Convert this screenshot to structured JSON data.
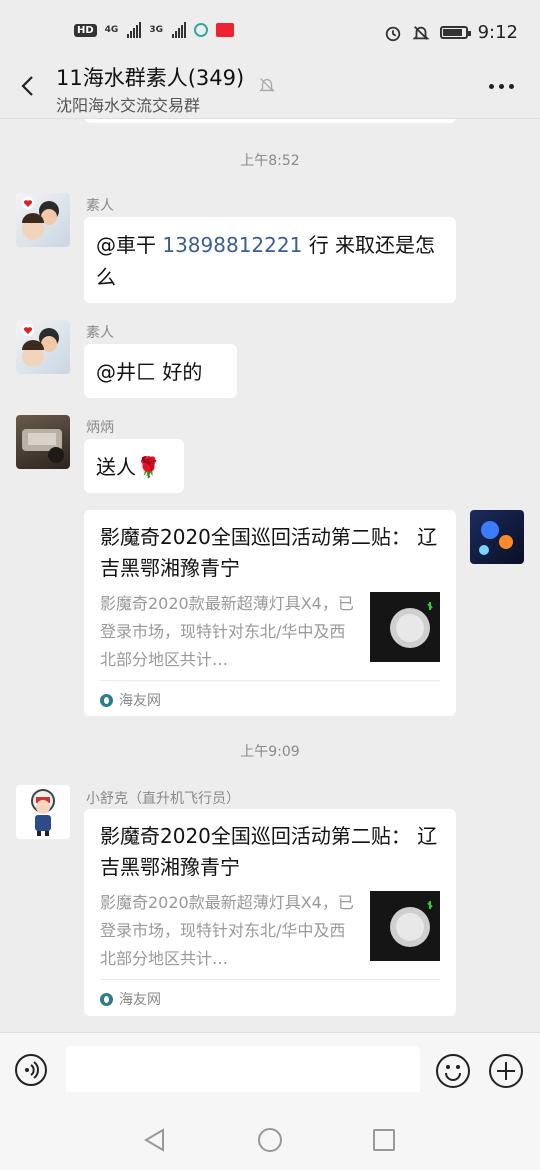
{
  "status_bar": {
    "hd_badge": "HD",
    "network_1": "4G",
    "network_2": "3G",
    "time": "9:12"
  },
  "header": {
    "title": "11海水群素人(349)",
    "subtitle": "沈阳海水交流交易群"
  },
  "messages": [
    {
      "type": "timestamp",
      "text": "上午8:52"
    },
    {
      "type": "text",
      "sender": "素人",
      "text_prefix": "@車干 ",
      "phone": "13898812221",
      "text_suffix": " 行 来取还是怎么"
    },
    {
      "type": "text",
      "sender": "素人",
      "text": "@井匚  好的"
    },
    {
      "type": "text",
      "sender": "炳炳",
      "text": "送人",
      "emoji": "🌹"
    },
    {
      "type": "link",
      "title": "影魔奇2020全国巡回活动第二贴： 辽吉黑鄂湘豫青宁",
      "desc": "影魔奇2020款最新超薄灯具X4，已登录市场，现特针对东北/华中及西北部分地区共计…",
      "source": "海友网"
    },
    {
      "type": "timestamp",
      "text": "上午9:09"
    },
    {
      "type": "link",
      "sender": "小舒克（直升机飞行员）",
      "title": "影魔奇2020全国巡回活动第二贴： 辽吉黑鄂湘豫青宁",
      "desc": "影魔奇2020款最新超薄灯具X4，已登录市场，现特针对东北/华中及西北部分地区共计…",
      "source": "海友网"
    }
  ],
  "input": {
    "placeholder": ""
  },
  "colors": {
    "background": "#ededed",
    "bubble": "#ffffff",
    "link_blue": "#3b5e8c",
    "meta_gray": "#8a8a8a"
  }
}
